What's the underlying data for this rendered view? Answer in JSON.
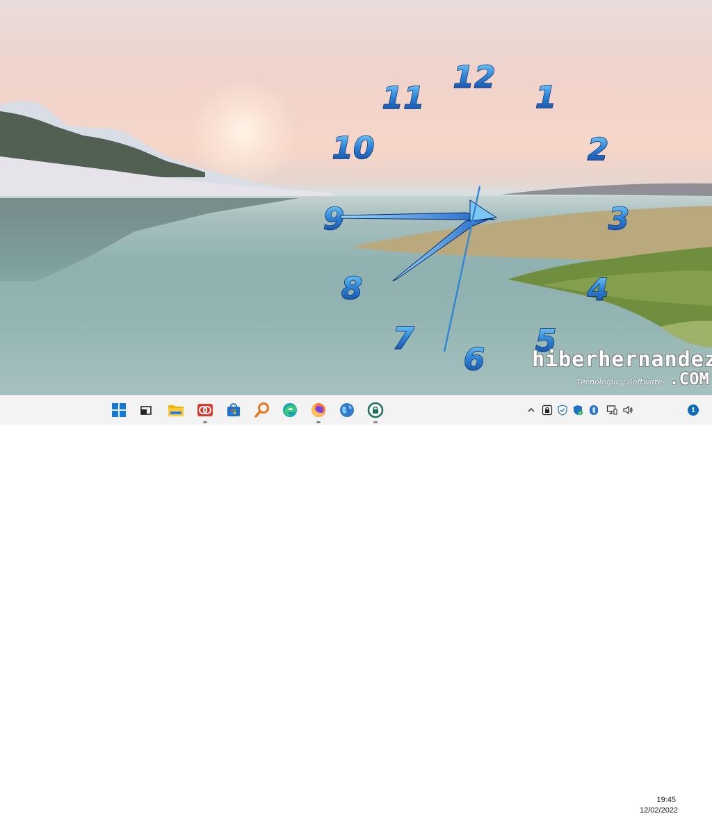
{
  "clock_gadget": {
    "numerals": [
      "12",
      "1",
      "2",
      "3",
      "4",
      "5",
      "6",
      "7",
      "8",
      "9",
      "10",
      "11"
    ]
  },
  "watermark": {
    "main": "hiberhernandez",
    "sub": "-Tecnologia y Software-",
    "domain": ".COM"
  },
  "taskbar": {
    "apps": [
      {
        "name": "start-button",
        "icon": "windows-logo-icon"
      },
      {
        "name": "task-view-button",
        "icon": "task-view-icon"
      },
      {
        "name": "file-explorer-button",
        "icon": "folder-icon"
      },
      {
        "name": "reader-app-button",
        "icon": "red-reader-icon"
      },
      {
        "name": "store-button",
        "icon": "store-bag-icon"
      },
      {
        "name": "search-app-button",
        "icon": "magnifier-icon"
      },
      {
        "name": "edge-button",
        "icon": "edge-icon"
      },
      {
        "name": "firefox-button",
        "icon": "firefox-icon"
      },
      {
        "name": "globe-app-button",
        "icon": "globe-icon"
      },
      {
        "name": "lock-app-button",
        "icon": "lock-circle-icon"
      }
    ],
    "tray": {
      "time": "19:45",
      "date": "12/02/2022",
      "notification_count": "1"
    }
  },
  "colors": {
    "clock_numeral": "#2f86d8",
    "clock_numeral_outline": "#0b2a6b",
    "taskbar_bg": "#f3f3f3",
    "accent": "#0f6cbd"
  }
}
